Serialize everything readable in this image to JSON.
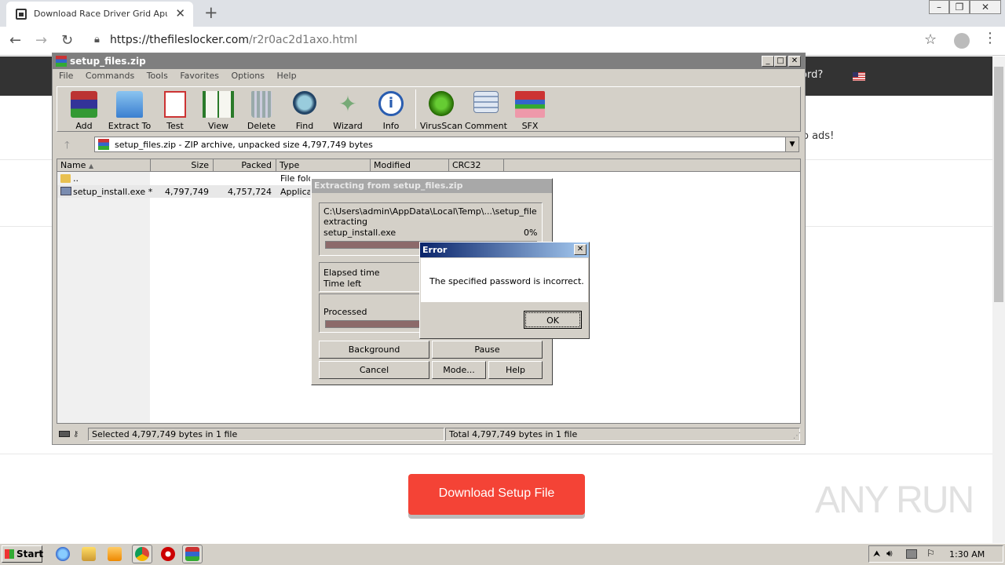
{
  "browser": {
    "tab_title": "Download Race Driver Grid Apun Ka",
    "url_host": "https://thefileslocker.com",
    "url_path": "/r2r0ac2d1axo.html"
  },
  "webpage": {
    "header_partial_text": "ord?",
    "ads_partial_text": "o ads!",
    "download_button": "Download Setup File",
    "watermark": "ANY RUN"
  },
  "winrar": {
    "title": "setup_files.zip",
    "menu": [
      "File",
      "Commands",
      "Tools",
      "Favorites",
      "Options",
      "Help"
    ],
    "tools": [
      {
        "label": "Add",
        "icon": "add-archive-icon"
      },
      {
        "label": "Extract To",
        "icon": "extract-folder-icon"
      },
      {
        "label": "Test",
        "icon": "test-clipboard-icon"
      },
      {
        "label": "View",
        "icon": "view-book-icon"
      },
      {
        "label": "Delete",
        "icon": "trash-icon"
      },
      {
        "label": "Find",
        "icon": "magnifier-icon"
      },
      {
        "label": "Wizard",
        "icon": "wand-icon"
      },
      {
        "label": "Info",
        "icon": "info-icon"
      },
      {
        "label": "VirusScan",
        "icon": "bug-icon"
      },
      {
        "label": "Comment",
        "icon": "comment-icon"
      },
      {
        "label": "SFX",
        "icon": "sfx-box-icon"
      }
    ],
    "address": "setup_files.zip - ZIP archive, unpacked size 4,797,749 bytes",
    "columns": [
      "Name",
      "Size",
      "Packed",
      "Type",
      "Modified",
      "CRC32"
    ],
    "rows": [
      {
        "name": "..",
        "size": "",
        "packed": "",
        "type": "File fold"
      },
      {
        "name": "setup_install.exe *",
        "size": "4,797,749",
        "packed": "4,757,724",
        "type": "Applicat"
      }
    ],
    "status_left": "Selected 4,797,749 bytes in 1 file",
    "status_right": "Total 4,797,749 bytes in 1 file"
  },
  "extract_dialog": {
    "title": "Extracting from setup_files.zip",
    "path": "C:\\Users\\admin\\AppData\\Local\\Temp\\...\\setup_files.zip",
    "action": "extracting",
    "file": "setup_install.exe",
    "percent": "0%",
    "elapsed_label": "Elapsed time",
    "left_label": "Time left",
    "processed_label": "Processed",
    "progress_fraction": 0.45,
    "buttons": {
      "background": "Background",
      "pause": "Pause",
      "cancel": "Cancel",
      "mode": "Mode...",
      "help": "Help"
    }
  },
  "error_dialog": {
    "title": "Error",
    "message": "The specified password is incorrect.",
    "ok": "OK"
  },
  "taskbar": {
    "start": "Start",
    "clock": "1:30 AM"
  },
  "colors": {
    "download_button": "#f44336",
    "error_title": "#0a246a",
    "progress_fill": "#8c6a6a"
  }
}
